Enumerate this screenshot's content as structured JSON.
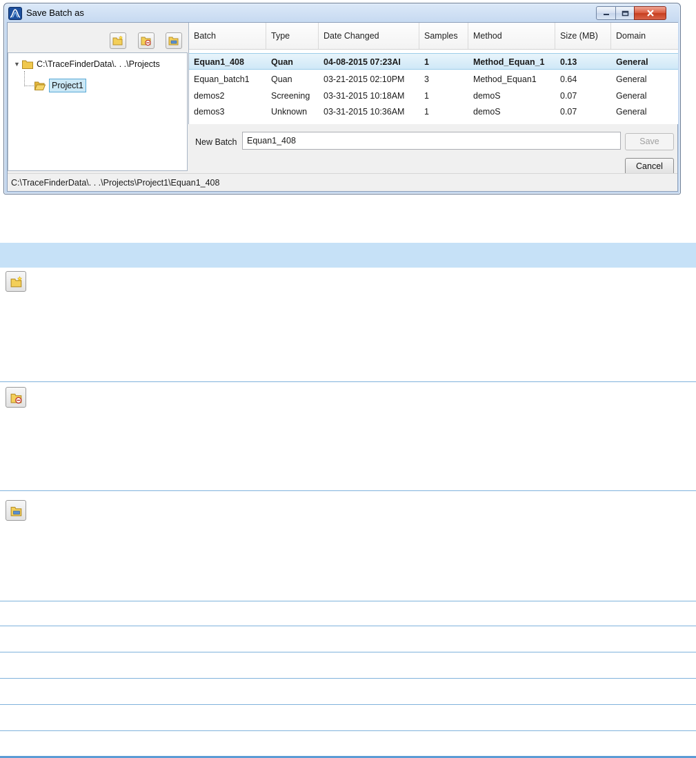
{
  "window": {
    "title": "Save Batch as"
  },
  "toolbar": {
    "icons": [
      "new-folder-icon",
      "delete-folder-icon",
      "rename-folder-icon"
    ]
  },
  "tree": {
    "root_label": "C:\\TraceFinderData\\. . .\\Projects",
    "child_label": "Project1"
  },
  "grid": {
    "columns": [
      "Batch",
      "Type",
      "Date Changed",
      "Samples",
      "Method",
      "Size (MB)",
      "Domain"
    ],
    "rows": [
      {
        "batch": "Equan1_408",
        "type": "Quan",
        "date": "04-08-2015 07:23AI",
        "samples": "1",
        "method": "Method_Equan_1",
        "size": "0.13",
        "domain": "General",
        "selected": true
      },
      {
        "batch": "Equan_batch1",
        "type": "Quan",
        "date": "03-21-2015 02:10PM",
        "samples": "3",
        "method": "Method_Equan1",
        "size": "0.64",
        "domain": "General",
        "selected": false
      },
      {
        "batch": "demos2",
        "type": "Screening",
        "date": "03-31-2015 10:18AM",
        "samples": "1",
        "method": "demoS",
        "size": "0.07",
        "domain": "General",
        "selected": false
      },
      {
        "batch": "demos3",
        "type": "Unknown",
        "date": "03-31-2015 10:36AM",
        "samples": "1",
        "method": "demoS",
        "size": "0.07",
        "domain": "General",
        "selected": false
      }
    ]
  },
  "form": {
    "new_batch_label": "New Batch",
    "new_batch_value": "Equan1_408",
    "save_label": "Save",
    "cancel_label": "Cancel"
  },
  "status": {
    "path": "C:\\TraceFinderData\\. . .\\Projects\\Project1\\Equan1_408"
  },
  "doc_table": {
    "icons": [
      "new-folder-icon",
      "delete-folder-icon",
      "rename-folder-icon"
    ]
  },
  "colors": {
    "header_band": "#c6e1f7",
    "rule": "#7fb2dc",
    "selected_row": "#cfe8f7"
  }
}
